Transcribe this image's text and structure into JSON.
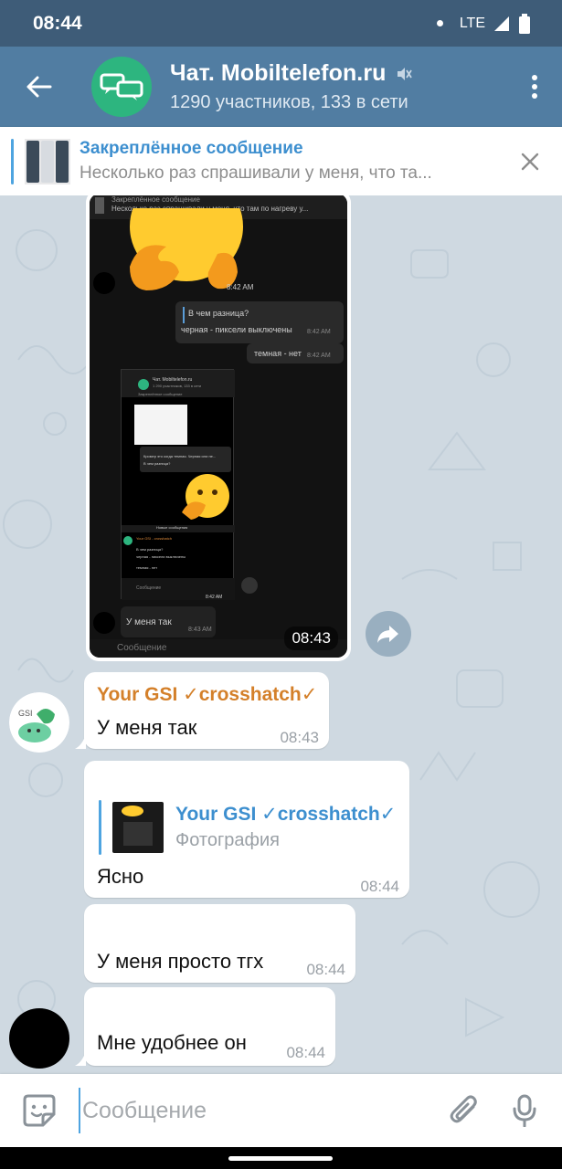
{
  "status_bar": {
    "time": "08:44",
    "network": "LTE"
  },
  "header": {
    "title": "Чат. Mobiltelefon.ru",
    "subtitle": "1290 участников, 133 в сети",
    "back_icon": "arrow-left-icon",
    "muted_icon": "muted-speaker-icon",
    "menu_icon": "more-vert-icon",
    "avatar_color": "#2db57f"
  },
  "pinned": {
    "title": "Закреплённое сообщение",
    "text": "Несколько раз спрашивали у меня, что та..."
  },
  "image_message": {
    "time": "08:43",
    "inner": {
      "pinned_preview": "Несколько раз спрашивали у меня, что там по нагреву у...",
      "pinned_header": "Закреплённое сообщение",
      "time1": "8:42 AM",
      "quote_line1": "В чем разница?",
      "quote_line2": "черная - пиксели выключены",
      "quote_time": "8:42 AM",
      "reply_text": "темная - нет",
      "reply_time": "8:42 AM",
      "nested_title": "Чат. Mobiltelefon.ru",
      "nested_sub": "1 290 участников, 133 в сети",
      "nested_pinned": "Закреплённое сообщение",
      "nested_quote": "Кромер это когда темная. Черная или не...",
      "nested_q2": "В чем разница?",
      "new_messages": "Новые сообщения",
      "nested_name": "Your GSI - crosshatch",
      "nested_a": "В чем разница?",
      "nested_b": "черная - пиксели выключены",
      "nested_c": "темная - нет",
      "nested_input": "Сообщение",
      "nested_time": "8:42 AM",
      "bottom_msg": "У меня так",
      "bottom_time": "8:43 AM",
      "input_placeholder": "Сообщение"
    }
  },
  "messages": [
    {
      "sender": "Your GSI ✓crosshatch✓",
      "text": "У меня так",
      "time": "08:43"
    },
    {
      "reply_name": "Your GSI ✓crosshatch✓",
      "reply_type": "Фотография",
      "text": "Ясно",
      "time": "08:44"
    },
    {
      "text": "У меня просто тгх",
      "time": "08:44"
    },
    {
      "text": "Мне удобнее он",
      "time": "08:44"
    }
  ],
  "input": {
    "placeholder": "Сообщение"
  },
  "colors": {
    "status_bar": "#3e5c78",
    "app_bar": "#517da2",
    "accent": "#4ea4e0",
    "sender_name": "#d4802a"
  }
}
